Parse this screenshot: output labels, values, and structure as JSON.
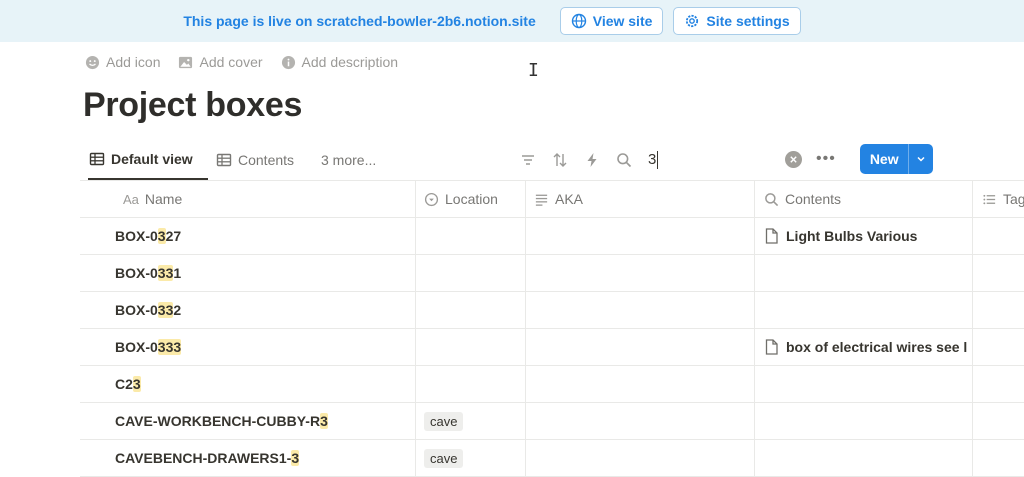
{
  "banner": {
    "text": "This page is live on scratched-bowler-2b6.notion.site",
    "view_site_label": "View site",
    "site_settings_label": "Site settings"
  },
  "page_actions": {
    "add_icon": "Add icon",
    "add_cover": "Add cover",
    "add_description": "Add description"
  },
  "page": {
    "title": "Project boxes"
  },
  "views": {
    "default_view": "Default view",
    "contents": "Contents",
    "more": "3 more..."
  },
  "search": {
    "value": "3"
  },
  "new_button": {
    "label": "New"
  },
  "columns": {
    "name": "Name",
    "name_type_glyph": "Aa",
    "location": "Location",
    "aka": "AKA",
    "contents": "Contents",
    "tags": "Tag"
  },
  "rows": [
    {
      "name_pre": "BOX-0",
      "name_hl": "3",
      "name_post": "27",
      "location": "",
      "aka": "",
      "contents": "Light Bulbs Various"
    },
    {
      "name_pre": "BOX-0",
      "name_hl": "33",
      "name_post": "1",
      "location": "",
      "aka": "",
      "contents": ""
    },
    {
      "name_pre": "BOX-0",
      "name_hl": "33",
      "name_post": "2",
      "location": "",
      "aka": "",
      "contents": ""
    },
    {
      "name_pre": "BOX-0",
      "name_hl": "333",
      "name_post": "",
      "location": "",
      "aka": "",
      "contents": "box of electrical wires see l"
    },
    {
      "name_pre": "C2",
      "name_hl": "3",
      "name_post": "",
      "location": "",
      "aka": "",
      "contents": ""
    },
    {
      "name_pre": "CAVE-WORKBENCH-CUBBY-R",
      "name_hl": "3",
      "name_post": "",
      "location": "cave",
      "aka": "",
      "contents": ""
    },
    {
      "name_pre": "CAVEBENCH-DRAWERS1-",
      "name_hl": "3",
      "name_post": "",
      "location": "cave",
      "aka": "",
      "contents": ""
    }
  ],
  "colors": {
    "banner_bg": "#e7f3f8",
    "accent": "#2383e2",
    "highlight": "#fbeaa9"
  },
  "icons": [
    "globe-icon",
    "gear-icon",
    "smiley-icon",
    "image-icon",
    "info-icon",
    "table-icon",
    "filter-icon",
    "sort-icon",
    "lightning-icon",
    "search-icon",
    "clear-icon",
    "more-icon",
    "chevron-down-icon",
    "select-icon",
    "text-lines-icon",
    "list-icon",
    "page-icon"
  ]
}
